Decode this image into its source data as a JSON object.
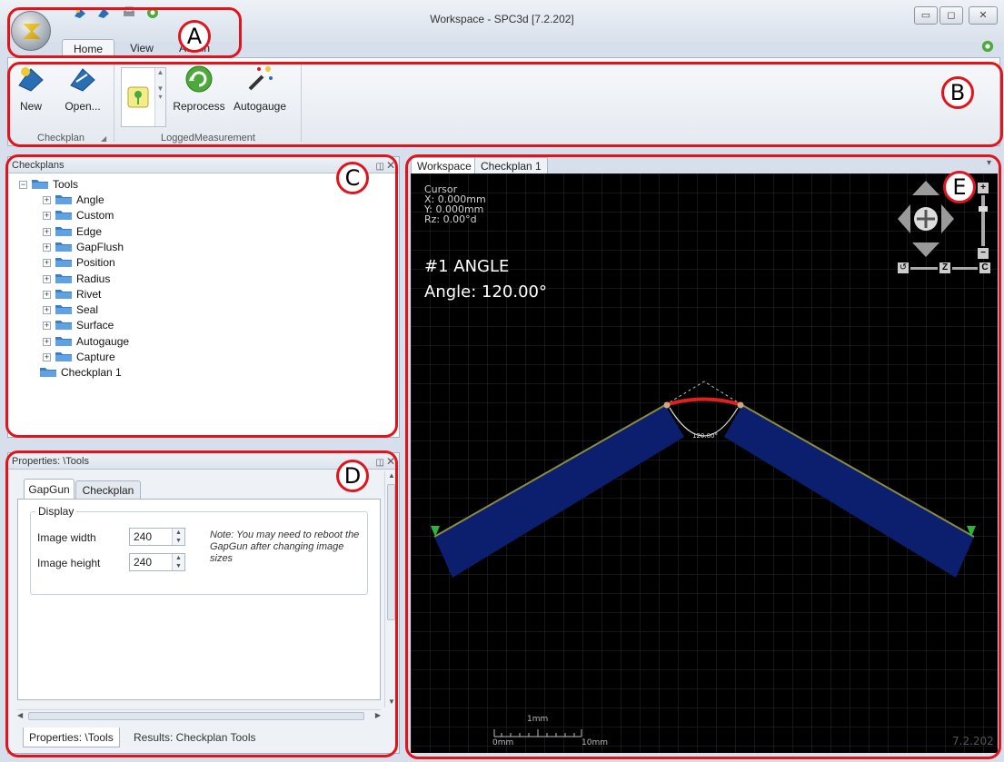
{
  "window": {
    "title": "Workspace - SPC3d [7.2.202]",
    "controls": {
      "minimize": "▭",
      "maximize": "◻",
      "close": "✕"
    }
  },
  "ribbon_tabs": [
    "Home",
    "View",
    "Admin"
  ],
  "ribbon": {
    "groups": [
      {
        "label": "Checkplan",
        "buttons": [
          "New",
          "Open..."
        ]
      },
      {
        "label": "LoggedMeasurement",
        "buttons": [
          "Reprocess",
          "Autogauge"
        ]
      }
    ]
  },
  "checkplans_panel": {
    "title": "Checkplans",
    "root": "Tools",
    "items": [
      "Angle",
      "Custom",
      "Edge",
      "GapFlush",
      "Position",
      "Radius",
      "Rivet",
      "Seal",
      "Surface",
      "Autogauge",
      "Capture"
    ],
    "checkplan": "Checkplan 1"
  },
  "properties_panel": {
    "title": "Properties: \\Tools",
    "tabs": [
      "GapGun",
      "Checkplan"
    ],
    "group": "Display",
    "fields": [
      {
        "label": "Image width",
        "value": "240"
      },
      {
        "label": "Image height",
        "value": "240"
      }
    ],
    "note": "Note: You may need to reboot the GapGun after changing image sizes",
    "bottom_tabs": [
      "Properties: \\Tools",
      "Results: Checkplan Tools"
    ]
  },
  "workspace": {
    "tabs": [
      "Workspace",
      "Checkplan 1"
    ],
    "cursor": {
      "heading": "Cursor",
      "x": "X: 0.000mm",
      "y": "Y: 0.000mm",
      "rz": "Rz: 0.00°d"
    },
    "measurement": {
      "name": "#1 ANGLE",
      "value": "Angle: 120.00°",
      "arc_label": "120.00°"
    },
    "scale": {
      "unit": "1mm",
      "start": "0mm",
      "end": "10mm"
    },
    "version": "7.2.202",
    "nav_zoom": {
      "plus": "+",
      "minus": "−",
      "z": "Z",
      "c": "C"
    }
  },
  "callouts": [
    "A",
    "B",
    "C",
    "D",
    "E"
  ],
  "colors": {
    "callout": "#e2141b",
    "part_fill": "#0c1f6e",
    "arc": "#e02020"
  }
}
